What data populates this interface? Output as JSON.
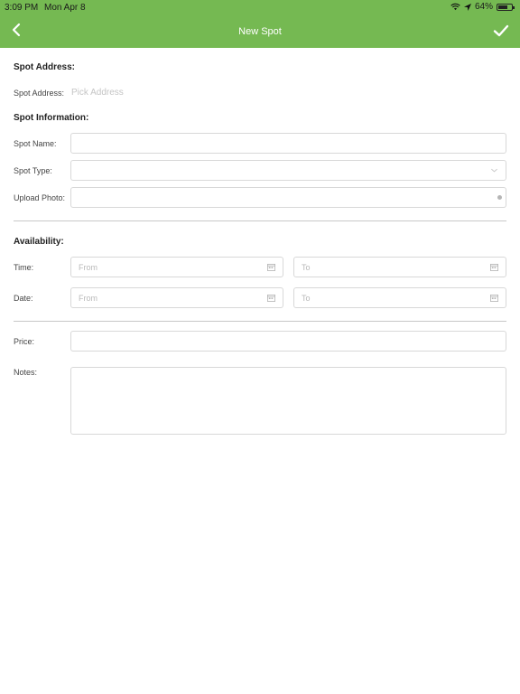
{
  "status_bar": {
    "time": "3:09 PM",
    "date": "Mon Apr 8",
    "battery": "64%"
  },
  "header": {
    "title": "New Spot"
  },
  "spot_address": {
    "section_title": "Spot Address:",
    "label": "Spot Address:",
    "placeholder": "Pick Address"
  },
  "spot_information": {
    "section_title": "Spot Information:",
    "name_label": "Spot Name:",
    "type_label": "Spot Type:",
    "photo_label": "Upload Photo:"
  },
  "availability": {
    "section_title": "Availability:",
    "time_label": "Time:",
    "date_label": "Date:",
    "from_placeholder": "From",
    "to_placeholder": "To"
  },
  "price": {
    "label": "Price:"
  },
  "notes": {
    "label": "Notes:"
  },
  "colors": {
    "header": "#75b952"
  }
}
